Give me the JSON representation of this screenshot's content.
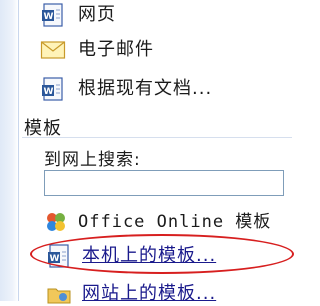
{
  "new_from": {
    "web_page_label": "网页",
    "email_label": "电子邮件",
    "existing_doc_label": "根据现有文档..."
  },
  "templates": {
    "section_title": "模板",
    "search_caption": "到网上搜索:",
    "search_value": "",
    "office_online_label": "Office Online 模板",
    "local_templates_label": "本机上的模板...",
    "website_templates_label": "网站上的模板..."
  },
  "colors": {
    "highlight_ellipse": "#d71f1f",
    "link": "#1a1a8c",
    "panel_strip": "#dfe9f7"
  },
  "icons": [
    "word-doc-icon",
    "envelope-icon",
    "office-logo-icon",
    "folder-web-icon"
  ]
}
